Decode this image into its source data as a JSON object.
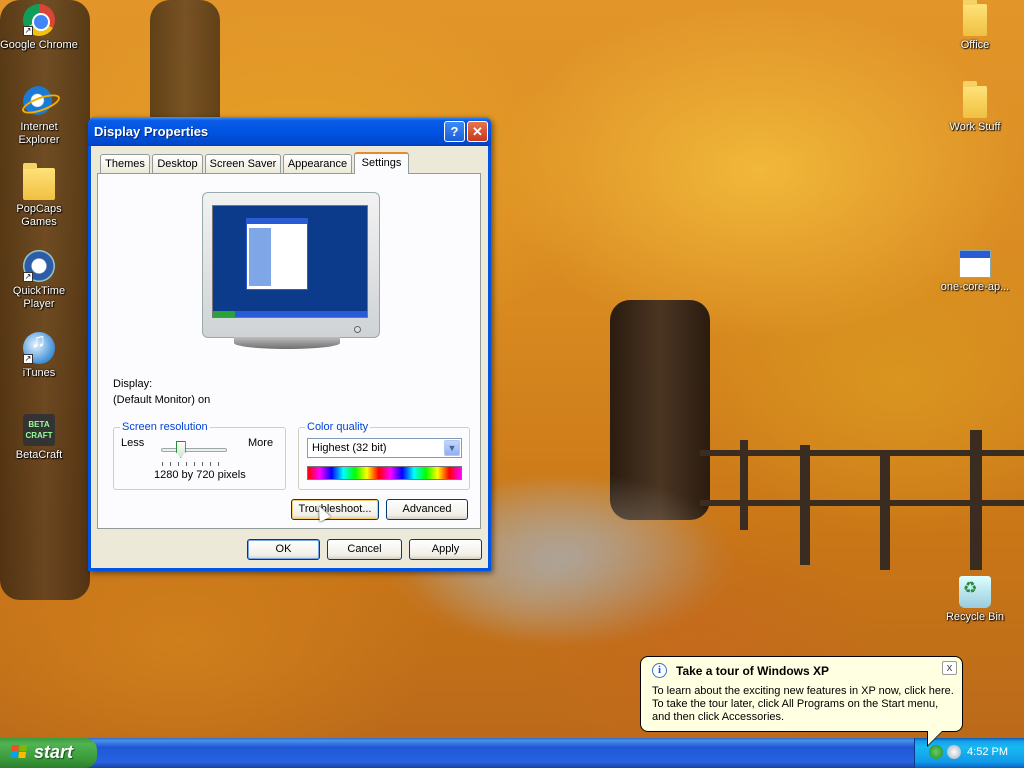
{
  "desktop": {
    "icons_left": [
      {
        "label": "Google Chrome",
        "icon": "chrome-icon"
      },
      {
        "label": "Internet Explorer",
        "icon": "internet-explorer-icon"
      },
      {
        "label": "PopCaps Games",
        "icon": "folder-icon"
      },
      {
        "label": "QuickTime Player",
        "icon": "quicktime-icon"
      },
      {
        "label": "iTunes",
        "icon": "itunes-icon"
      },
      {
        "label": "BetaCraft",
        "icon": "betacraft-icon"
      }
    ],
    "icons_right": [
      {
        "label": "Office",
        "icon": "folder-icon"
      },
      {
        "label": "Work Stuff",
        "icon": "folder-icon"
      },
      {
        "label": "one-core-ap...",
        "icon": "application-icon"
      },
      {
        "label": "Recycle Bin",
        "icon": "recycle-bin-icon"
      }
    ]
  },
  "window": {
    "title": "Display Properties",
    "help_glyph": "?",
    "close_glyph": "✕",
    "tabs": [
      "Themes",
      "Desktop",
      "Screen Saver",
      "Appearance",
      "Settings"
    ],
    "active_tab": "Settings",
    "display_label": "Display:",
    "display_value": "(Default Monitor) on",
    "resolution": {
      "group_title": "Screen resolution",
      "less": "Less",
      "more": "More",
      "value": "1280 by 720 pixels",
      "slider_level": 0.3
    },
    "color_quality": {
      "group_title": "Color quality",
      "selected": "Highest (32 bit)"
    },
    "buttons": {
      "troubleshoot": "Troubleshoot...",
      "advanced": "Advanced",
      "ok": "OK",
      "cancel": "Cancel",
      "apply": "Apply"
    }
  },
  "balloon": {
    "title": "Take a tour of Windows XP",
    "close_glyph": "x",
    "lines": [
      "To learn about the exciting new features in XP now, click here.",
      "To take the tour later, click All Programs on the Start menu,",
      "and then click Accessories."
    ]
  },
  "taskbar": {
    "start_label": "start",
    "clock": "4:52 PM"
  },
  "colors": {
    "titlebar": "#0054e3",
    "taskbar": "#2157d7",
    "start_button": "#3a9a3a",
    "dialog_bg": "#ece9d8",
    "balloon_bg": "#ffffe1",
    "group_title": "#0046d5"
  }
}
